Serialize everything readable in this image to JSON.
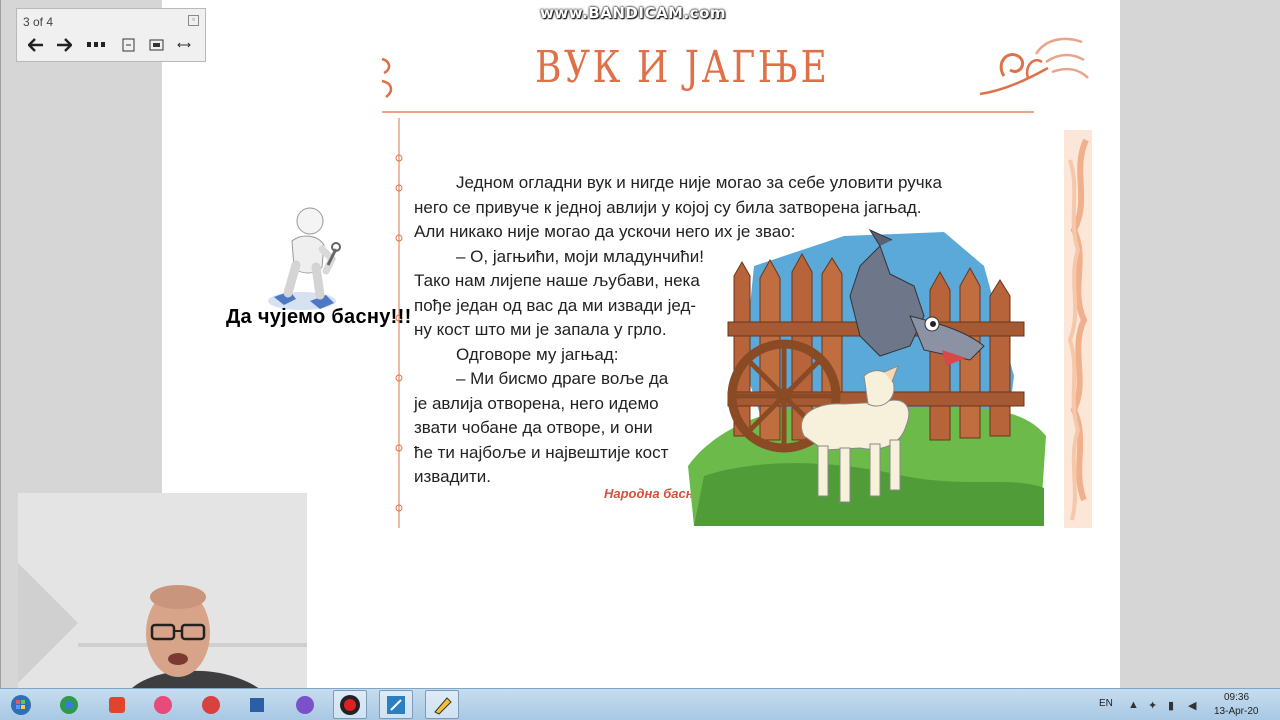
{
  "viewer": {
    "page_counter": "3 of 4",
    "watermark": "www.BANDICAM.com"
  },
  "nav_icons": [
    "arrow-left-icon",
    "arrow-right-icon",
    "more-icon",
    "fit-page-icon",
    "fullscreen-icon",
    "fit-width-icon"
  ],
  "slide": {
    "title": "ВУК И ЈАГЊЕ",
    "lines": [
      "Једном огладни вук и нигде није могао за себе уловити ручка",
      "него се привуче к једној авлији у којој су била затворена јагњад.",
      "Али никако није могао да ускочи него их је звао:",
      "– О, јагњићи, моји младунчићи!",
      "Тако нам лијепе наше љубави, нека",
      "пође један од вас да ми извади јед-",
      "ну кост што ми је запала у грло.",
      "Одговоре му јагњад:",
      "– Ми бисмо драге воље да",
      "је авлија отворена, него идемо",
      "звати чобане да отворе, и они",
      "ће ти најбоље и највештије кост",
      "извадити."
    ],
    "source": "Народна басна"
  },
  "overlay": {
    "caption": "Да чујемо басну!!!"
  },
  "taskbar": {
    "language": "EN",
    "time": "09:36",
    "date": "13-Apr-20"
  },
  "colors": {
    "title": "#e07048",
    "ornament": "#e9a488",
    "source": "#d0523a"
  }
}
